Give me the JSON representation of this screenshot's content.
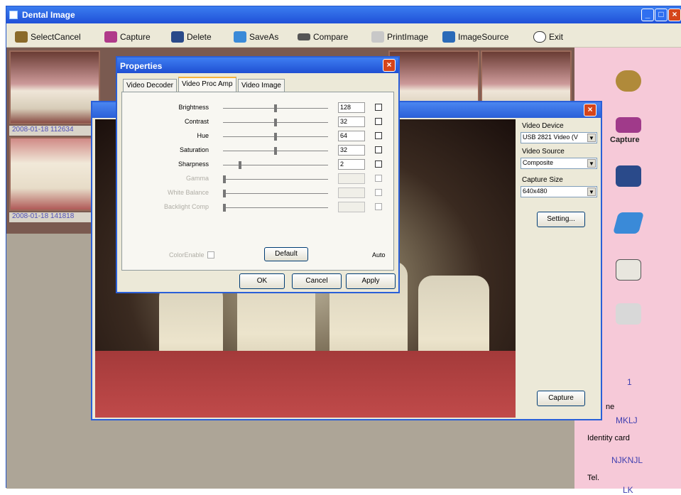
{
  "app": {
    "title": "Dental Image"
  },
  "toolbar": {
    "select_cancel": "SelectCancel",
    "capture": "Capture",
    "delete": "Delete",
    "save_as": "SaveAs",
    "compare": "Compare",
    "print_image": "PrintImage",
    "image_source": "ImageSource",
    "exit": "Exit"
  },
  "thumbnails": [
    {
      "label": "2008-01-18 112634"
    },
    {
      "label": "2008-01-18 141818"
    }
  ],
  "right_panel": {
    "capture_label": "Capture",
    "number": "1",
    "name_label": "ne",
    "name_value": "MKLJ",
    "identity_label": "Identity card",
    "identity_value": "NJKNJL",
    "tel_label": "Tel.",
    "tel_value": "LK"
  },
  "video_window": {
    "video_device_label": "Video Device",
    "video_device_value": "USB 2821 Video (V",
    "video_source_label": "Video Source",
    "video_source_value": "Composite",
    "capture_size_label": "Capture Size",
    "capture_size_value": "640x480",
    "setting_button": "Setting...",
    "capture_button": "Capture"
  },
  "properties": {
    "title": "Properties",
    "tabs": [
      "Video Decoder",
      "Video Proc Amp",
      "Video Image"
    ],
    "rows": [
      {
        "label": "Brightness",
        "value": "128",
        "level": 0.5
      },
      {
        "label": "Contrast",
        "value": "32",
        "level": 0.5
      },
      {
        "label": "Hue",
        "value": "64",
        "level": 0.5
      },
      {
        "label": "Saturation",
        "value": "32",
        "level": 0.5
      },
      {
        "label": "Sharpness",
        "value": "2",
        "level": 0.15
      },
      {
        "label": "Gamma",
        "value": "",
        "level": 0.0
      },
      {
        "label": "White Balance",
        "value": "",
        "level": 0.0
      },
      {
        "label": "Backlight Comp",
        "value": "",
        "level": 0.0
      }
    ],
    "color_enable": "ColorEnable",
    "default_button": "Default",
    "auto_label": "Auto",
    "ok": "OK",
    "cancel": "Cancel",
    "apply": "Apply"
  }
}
